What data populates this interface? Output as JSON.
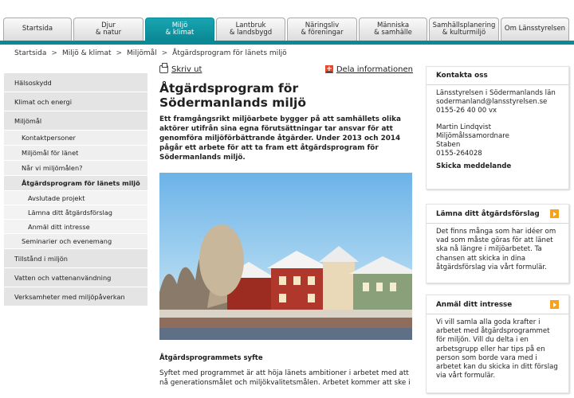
{
  "top_nav": {
    "tabs": [
      {
        "label": "Startsida"
      },
      {
        "label": "Djur\n& natur"
      },
      {
        "label": "Miljö\n& klimat",
        "active": true
      },
      {
        "label": "Lantbruk\n& landsbygd"
      },
      {
        "label": "Näringsliv\n& föreningar"
      },
      {
        "label": "Människa\n& samhälle"
      },
      {
        "label": "Samhällsplanering\n& kulturmiljö"
      },
      {
        "label": "Om Länsstyrelsen"
      }
    ]
  },
  "breadcrumb": {
    "items": [
      "Startsida",
      "Miljö & klimat",
      "Miljömål",
      "Åtgärdsprogram för länets miljö"
    ],
    "separator": ">"
  },
  "sidebar": {
    "items": [
      {
        "label": "Hälsoskydd"
      },
      {
        "label": "Klimat och energi"
      },
      {
        "label": "Miljömål"
      },
      {
        "label": "Kontaktpersoner"
      },
      {
        "label": "Miljömål för länet"
      },
      {
        "label": "Når vi miljömålen?"
      },
      {
        "label": "Åtgärdsprogram för länets miljö"
      },
      {
        "label": "Avslutade projekt"
      },
      {
        "label": "Lämna ditt åtgärdsförslag"
      },
      {
        "label": "Anmäl ditt intresse"
      },
      {
        "label": "Seminarier och evenemang"
      },
      {
        "label": "Tillstånd i miljön"
      },
      {
        "label": "Vatten och vattenanvändning"
      },
      {
        "label": "Verksamheter med miljöpåverkan"
      }
    ]
  },
  "main": {
    "print_label": "Skriv ut",
    "share_label": "Dela informationen",
    "title": "Åtgärdsprogram för Södermanlands miljö",
    "lead": "Ett framgångsrikt miljöarbete bygger på att samhällets olika aktörer utifrån sina egna förutsättningar tar ansvar för att genomföra miljöförbättrande åtgärder. Under 2013 och 2014 pågår ett arbete för att ta fram ett åtgärdsprogram för Södermanlands miljö.",
    "subheading": "Åtgärdsprogrammets syfte",
    "body": "Syftet med programmet är att höja länets ambitioner i arbetet med att nå generationsmålet och miljökvalitetsmålen. Arbetet kommer att ske i"
  },
  "contact": {
    "title": "Kontakta oss",
    "org": "Länsstyrelsen i Södermanlands län",
    "email": "sodermanland@lansstyrelsen.se",
    "phone": "0155-26 40 00 vx",
    "person": "Martin Lindqvist",
    "role": "Miljömålssamordnare",
    "unit": "Staben",
    "person_phone": "0155-264028",
    "send_label": "Skicka meddelande"
  },
  "box_proposal": {
    "title": "Lämna ditt åtgärdsförslag",
    "text": "Det finns många som har idéer om vad som måste göras för att länet ska nå längre i miljöarbetet. Ta chansen att skicka in dina åtgärdsförslag via vårt formulär."
  },
  "box_interest": {
    "title": "Anmäl ditt intresse",
    "text": "Vi vill samla alla goda krafter i arbetet med åtgärdsprogrammet för miljön. Vill du delta i en arbetsgrupp eller har tips på en person som borde vara med i arbetet kan du skicka in ditt förslag via vårt formulär."
  },
  "colors": {
    "accent": "#0a8a96",
    "orange": "#f6a21b",
    "share_icon": "#e24b2a"
  }
}
